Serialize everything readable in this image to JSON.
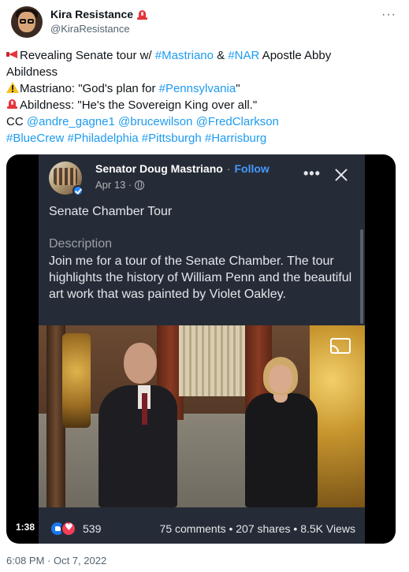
{
  "author": {
    "display_name": "Kira Resistance",
    "handle": "@KiraResistance",
    "badge_icon": "police-light-icon"
  },
  "tweet": {
    "line1": {
      "pre": "Revealing Senate tour w/ ",
      "tag1": "#Mastriano",
      "mid": " & ",
      "tag2": "#NAR",
      "post": " Apostle Abby"
    },
    "line2": "Abildness",
    "line3": {
      "pre": "Mastriano: \"God's plan for ",
      "tag": "#Pennsylvania",
      "post": "\""
    },
    "line4": "Abildness: \"He's the Sovereign King over all.\"",
    "line5": {
      "pre": "CC ",
      "m1": "@andre_gagne1",
      "m2": "@brucewilson",
      "m3": "@FredClarkson"
    },
    "line6": {
      "t1": "#BlueCrew",
      "t2": "#Philadelphia",
      "t3": "#Pittsburgh",
      "t4": "#Harrisburg"
    }
  },
  "video": {
    "duration": "1:38",
    "facebook_post": {
      "page_name": "Senator Doug Mastriano",
      "separator": "·",
      "follow_label": "Follow",
      "date": "Apr 13 ·",
      "title": "Senate Chamber Tour",
      "description_label": "Description",
      "description": "Join me for a tour of the Senate Chamber. The tour highlights the history of William Penn and the beautiful art work that was painted by Violet Oakley.",
      "reaction_count": "539",
      "stats": "75 comments • 207 shares • 8.5K Views"
    }
  },
  "timestamp": "6:08 PM · Oct 7, 2022",
  "colors": {
    "link": "#1d9bf0",
    "text": "#0f1419",
    "secondary": "#536471",
    "fb_panel": "#262c37",
    "fb_follow": "#4599ff"
  }
}
